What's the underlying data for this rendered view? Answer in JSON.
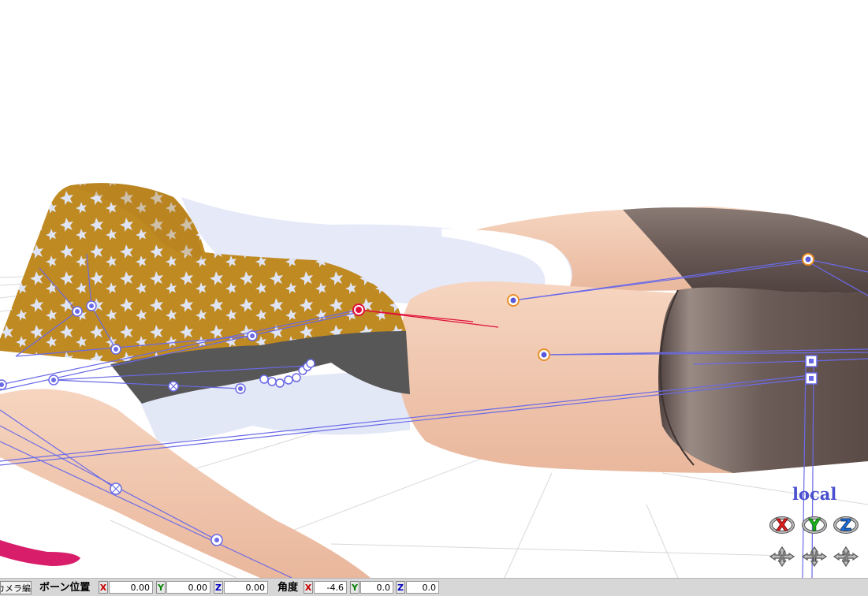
{
  "viewport": {
    "gizmo": {
      "space_label": "local",
      "axes": [
        {
          "axis": "X",
          "color": "#e02020"
        },
        {
          "axis": "Y",
          "color": "#20b020"
        },
        {
          "axis": "Z",
          "color": "#2070e0"
        }
      ],
      "move_icons": [
        "move-x-icon",
        "move-y-icon",
        "move-z-icon"
      ],
      "rotate_icons": [
        "rotate-x-icon",
        "rotate-y-icon",
        "rotate-z-icon"
      ]
    },
    "colors": {
      "bone_line": "#6a6ae8",
      "selected_bone": "#e0103a",
      "ik_bone": "#e8902a",
      "skirt_pattern": "#c08a22",
      "stocking": "#6a5a56",
      "skin": "#f3c9b0"
    }
  },
  "statusbar": {
    "mode_tab": "カメラ編",
    "bone_position": {
      "label": "ボーン位置",
      "x_label": "X",
      "x": "0.00",
      "y_label": "Y",
      "y": "0.00",
      "z_label": "Z",
      "z": "0.00"
    },
    "angle": {
      "label": "角度",
      "x_label": "X",
      "x": "-4.6",
      "y_label": "Y",
      "y": "0.0",
      "z_label": "Z",
      "z": "0.0"
    }
  }
}
